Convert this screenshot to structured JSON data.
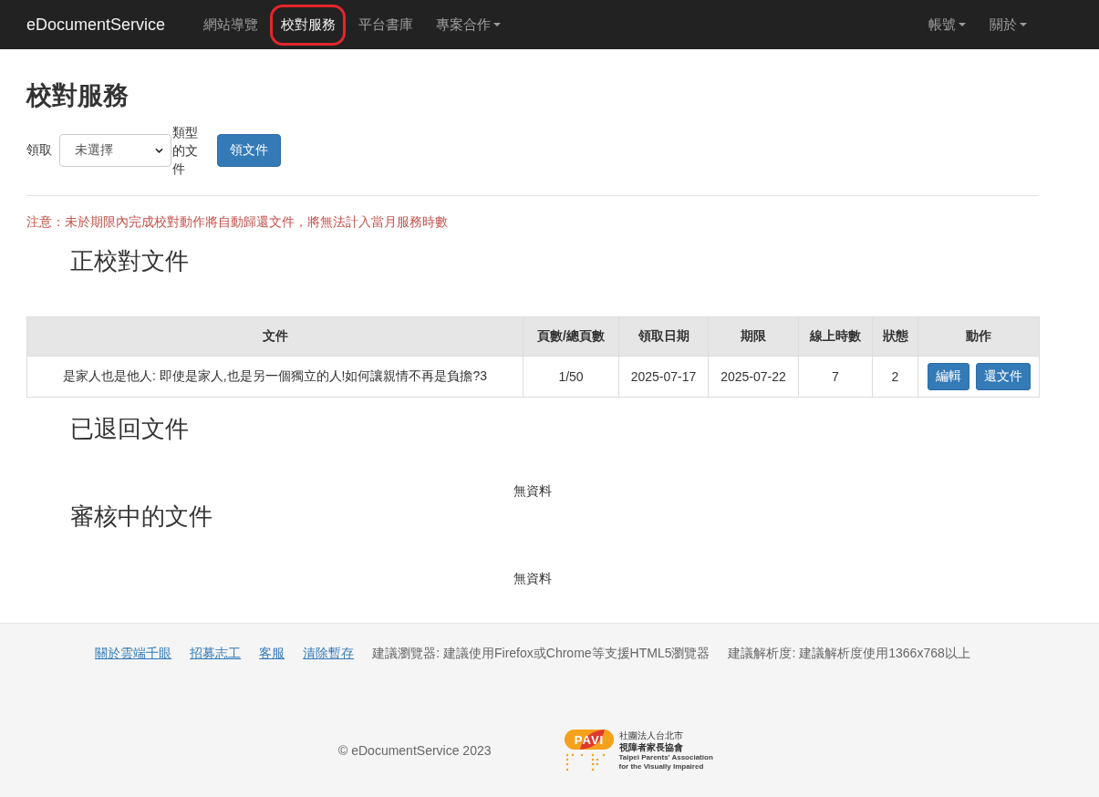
{
  "navbar": {
    "brand": "eDocumentService",
    "items": [
      {
        "label": "網站導覽",
        "selected": false,
        "dropdown": false,
        "highlighted": false
      },
      {
        "label": "校對服務",
        "selected": true,
        "dropdown": false,
        "highlighted": true
      },
      {
        "label": "平台書庫",
        "selected": false,
        "dropdown": false,
        "highlighted": false
      },
      {
        "label": "專案合作",
        "selected": false,
        "dropdown": true,
        "highlighted": false
      }
    ],
    "right_items": [
      {
        "label": "帳號",
        "dropdown": true
      },
      {
        "label": "關於",
        "dropdown": true
      }
    ]
  },
  "page_title": "校對服務",
  "request_form": {
    "label": "領取",
    "select": {
      "value": "未選擇"
    },
    "suffix": "類型的文件",
    "button": "領文件"
  },
  "notice": "注意：未於期限內完成校對動作將自動歸還文件，將無法計入當月服務時數",
  "sections": [
    {
      "title": "正校對文件",
      "table": {
        "columns": [
          "文件",
          "頁數/總頁數",
          "領取日期",
          "期限",
          "線上時數",
          "狀態",
          "動作"
        ],
        "rows": [
          {
            "cells": [
              "是家人也是他人: 即使是家人,也是另一個獨立的人!如何讓親情不再是負擔?3",
              "1/50",
              "2025-07-17",
              "2025-07-22",
              "7",
              "2"
            ],
            "actions": [
              "編輯",
              "還文件"
            ]
          }
        ]
      }
    },
    {
      "title": "已退回文件",
      "empty_text": "無資料"
    },
    {
      "title": "審核中的文件",
      "empty_text": "無資料"
    }
  ],
  "footer": {
    "links": [
      "關於雲端千眼",
      "招募志工",
      "客服",
      "清除暫存"
    ],
    "notes": [
      "建議瀏覽器: 建議使用Firefox或Chrome等支援HTML5瀏覽器",
      "建議解析度: 建議解析度使用1366x768以上"
    ],
    "copyright": "© eDocumentService 2023",
    "logo": {
      "emblem": "PAVI",
      "lines": [
        "社團法人台北市",
        "視障者家長協會",
        "Taipei Parents' Association",
        "for the Visually Impaired"
      ]
    }
  }
}
